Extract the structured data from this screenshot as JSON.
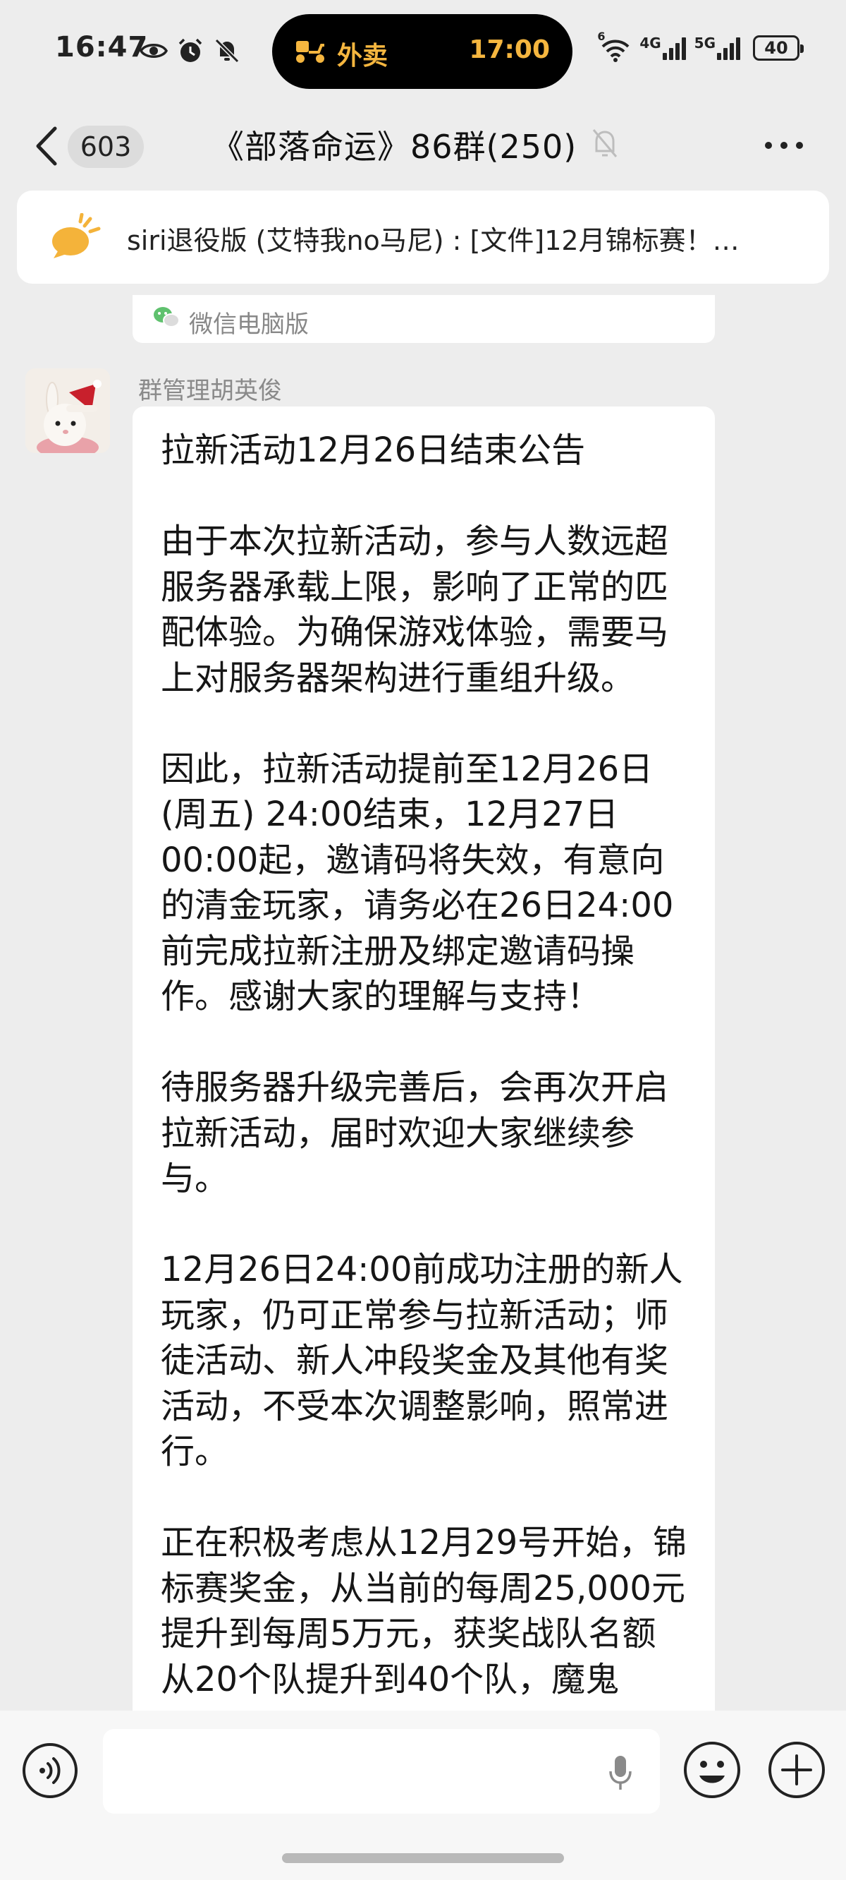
{
  "status_bar": {
    "time": "16:47",
    "island_label": "外卖",
    "island_time": "17:00",
    "net_1": "6",
    "net_2": "4G",
    "net_3": "5G",
    "battery": "40"
  },
  "header": {
    "unread_count": "603",
    "title": "《部落命运》86群(250)"
  },
  "pinned": {
    "text": "siri退役版 (艾特我no马尼) : [文件]12月锦标赛！…"
  },
  "previous_message": {
    "source_label": "微信电脑版"
  },
  "message": {
    "sender": "群管理胡英俊",
    "paragraphs": [
      "拉新活动12月26日结束公告",
      "由于本次拉新活动，参与人数远超服务器承载上限，影响了正常的匹配体验。为确保游戏体验，需要马上对服务器架构进行重组升级。",
      "因此，拉新活动提前至12月26日 (周五) 24:00结束，12月27日00:00起，邀请码将失效，有意向的清金玩家，请务必在26日24:00前完成拉新注册及绑定邀请码操作。感谢大家的理解与支持！",
      "待服务器升级完善后，会再次开启拉新活动，届时欢迎大家继续参与。",
      "12月26日24:00前成功注册的新人玩家，仍可正常参与拉新活动；师徒活动、新人冲段奖金及其他有奖活动，不受本次调整影响，照常进行。",
      "正在积极考虑从12月29号开始，锦标赛奖金，从当前的每周25,000元提升到每周5万元，获奖战队名额从20个队提升到40个队，魔鬼"
    ]
  },
  "input_bar": {
    "placeholder": ""
  },
  "colors": {
    "background": "#ededed",
    "bubble": "#ffffff",
    "island_accent": "#f5b63f",
    "pinned_icon": "#f4b33a"
  },
  "icons": [
    "eye-icon",
    "alarm-icon",
    "bell-off-icon",
    "scooter-icon",
    "wifi-icon",
    "battery-icon",
    "back-icon",
    "mute-icon",
    "more-icon",
    "announcement-icon",
    "wechat-pc-icon",
    "voice-icon",
    "mic-icon",
    "emoji-icon",
    "plus-icon"
  ]
}
